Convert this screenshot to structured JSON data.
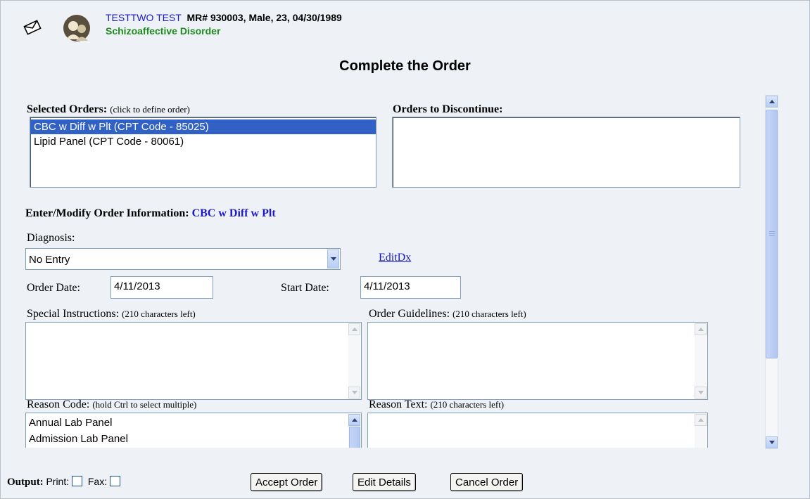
{
  "header": {
    "patient_name": "TESTTWO TEST",
    "patient_meta": "MR# 930003, Male, 23, 04/30/1989",
    "diagnosis": "Schizoaffective Disorder",
    "icons": [
      "envelope-icon",
      "patient-avatar-icon"
    ]
  },
  "title": "Complete the Order",
  "selected_orders": {
    "label": "Selected Orders:",
    "hint": "(click to define order)",
    "items": [
      "CBC w Diff w Plt (CPT Code - 85025)",
      "Lipid Panel (CPT Code - 80061)"
    ],
    "selected_index": 0
  },
  "discontinue": {
    "label": "Orders to Discontinue:"
  },
  "order_info": {
    "label": "Enter/Modify Order Information:",
    "name": "CBC w Diff w Plt"
  },
  "diagnosis_field": {
    "label": "Diagnosis:",
    "value": "No Entry",
    "edit_link": "EditDx"
  },
  "dates": {
    "order_label": "Order Date:",
    "order_value": "4/11/2013",
    "start_label": "Start Date:",
    "start_value": "4/11/2013"
  },
  "special_instructions": {
    "label": "Special Instructions:",
    "hint": "(210 characters left)"
  },
  "order_guidelines": {
    "label": "Order Guidelines:",
    "hint": "(210 characters left)"
  },
  "reason_code": {
    "label": "Reason Code:",
    "hint": "(hold Ctrl to select multiple)",
    "items": [
      "Annual Lab Panel",
      "Admission Lab Panel"
    ]
  },
  "reason_text": {
    "label": "Reason Text:",
    "hint": "(210 characters left)"
  },
  "output": {
    "label": "Output:",
    "print": "Print:",
    "fax": "Fax:"
  },
  "buttons": {
    "accept": "Accept Order",
    "edit": "Edit Details",
    "cancel": "Cancel Order"
  },
  "colors": {
    "link_blue": "#1a1acc",
    "diagnosis_green": "#1f8a1f",
    "selection": "#3161c4"
  }
}
